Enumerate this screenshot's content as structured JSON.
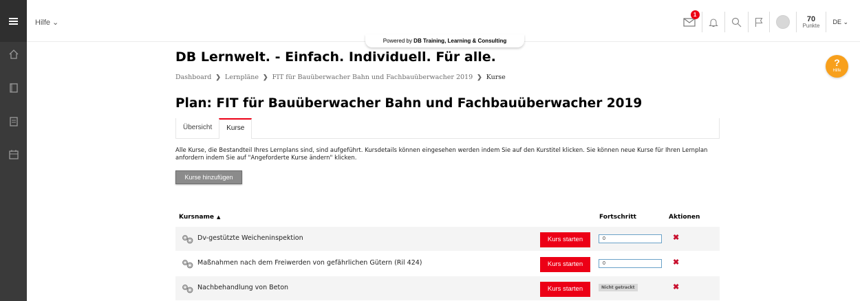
{
  "topbar": {
    "help_menu": "Hilfe ⌄",
    "mail_badge": "1",
    "points_value": "70",
    "points_label": "Punkte",
    "language": "DE ⌄"
  },
  "powered": {
    "prefix": "Powered by ",
    "brand": "DB Training, Learning & Consulting"
  },
  "help_button": {
    "label": "Hilfe",
    "symbol": "?"
  },
  "page": {
    "site_title": "DB Lernwelt. - Einfach. Individuell. Für alle.",
    "breadcrumb": [
      "Dashboard",
      "Lernpläne",
      "FIT für Bauüberwacher Bahn und Fachbauüberwacher 2019",
      "Kurse"
    ],
    "breadcrumb_sep": "❯",
    "plan_title": "Plan: FIT für Bauüberwacher Bahn und Fachbauüberwacher 2019",
    "tabs": [
      "Übersicht",
      "Kurse"
    ],
    "description": "Alle Kurse, die Bestandteil Ihres Lernplans sind, sind aufgeführt. Kursdetails können eingesehen werden indem Sie auf den Kurstitel klicken. Sie können neue Kurse für Ihren Lernplan anfordern indem Sie auf \"Angeforderte Kurse ändern\" klicken.",
    "add_button": "Kurse hinzufügen"
  },
  "table": {
    "headers": {
      "name": "Kursname",
      "progress": "Fortschritt",
      "actions": "Aktionen"
    },
    "sort_caret": "▲",
    "start_label": "Kurs starten",
    "delete_symbol": "✖",
    "rows": [
      {
        "name": "Dv-gestützte Weicheninspektion",
        "progress": "0"
      },
      {
        "name": "Maßnahmen nach dem Freiwerden von gefährlichen Gütern (Ril 424)",
        "progress": "0"
      },
      {
        "name": "Nachbehandlung von Beton",
        "progress": "Nicht getrackt"
      }
    ]
  },
  "colors": {
    "accent": "#ec0016",
    "sidebar": "#3a3a3a",
    "help": "#f8a01c",
    "button_grey": "#8b8b8b"
  }
}
